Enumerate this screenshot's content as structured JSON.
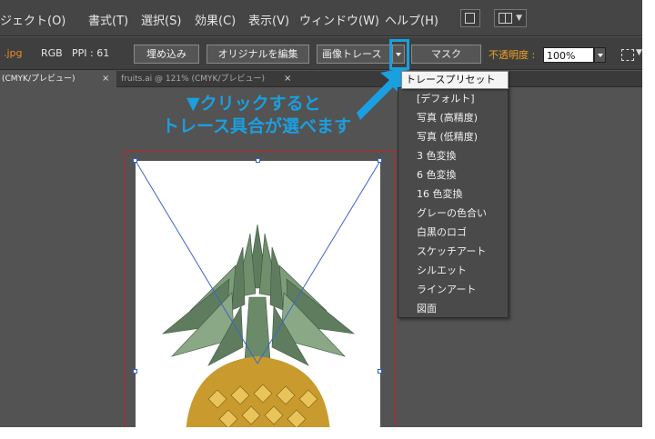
{
  "menu": {
    "items": [
      "ジェクト(O)",
      "書式(T)",
      "選択(S)",
      "効果(C)",
      "表示(V)",
      "ウィンドウ(W)",
      "ヘルプ(H)"
    ],
    "icons": [
      "bridge-icon",
      "arrange-documents-icon"
    ]
  },
  "control_bar": {
    "file_ext": ".jpg",
    "color_mode": "RGB",
    "ppi": "PPI : 61",
    "embed_button": "埋め込み",
    "edit_original_button": "オリジナルを編集",
    "image_trace_button": "画像トレース",
    "mask_button": "マスク",
    "opacity_label": "不透明度 :",
    "opacity_value": "100%"
  },
  "tabs": [
    {
      "label": "(CMYK/プレビュー)",
      "close": "×",
      "active": true
    },
    {
      "label": "fruits.ai @ 121% (CMYK/プレビュー)",
      "close": "×",
      "active": false
    }
  ],
  "annotation": {
    "line1": "▼クリックすると",
    "line2": "トレース具合が選べます"
  },
  "preset_menu": {
    "tooltip": "トレースプリセット",
    "items": [
      "[デフォルト]",
      "写真 (高精度)",
      "写真 (低精度)",
      "3 色変換",
      "6 色変換",
      "16 色変換",
      "グレーの色合い",
      "白黒のロゴ",
      "スケッチアート",
      "シルエット",
      "ラインアート",
      "図面"
    ]
  },
  "colors": {
    "highlight": "#1a9fe0",
    "warning_label": "#f0a020",
    "file_ext": "#f08a2a",
    "artboard_border": "#c0242c"
  }
}
